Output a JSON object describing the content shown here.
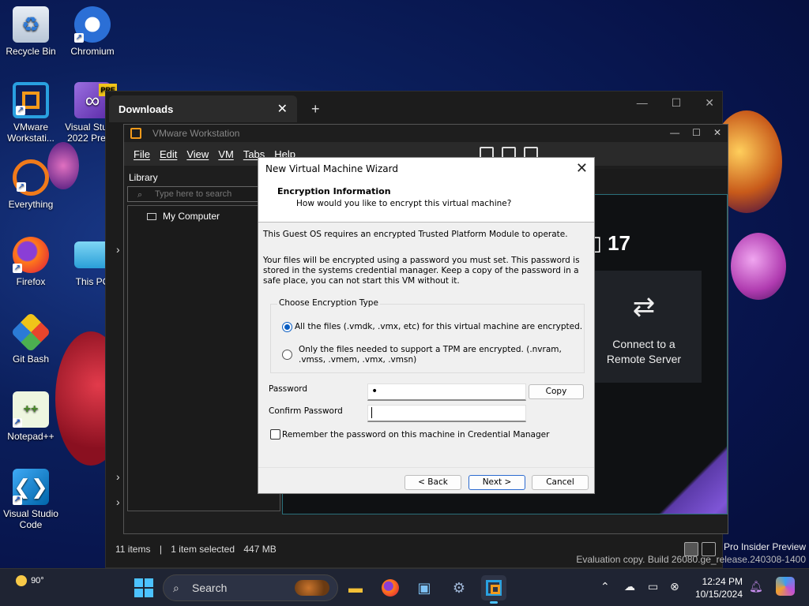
{
  "desktop": {
    "icons": [
      {
        "label": "Recycle Bin",
        "icon": "recycle-bin-icon"
      },
      {
        "label": "Chromium",
        "icon": "chromium-icon"
      },
      {
        "label": "VMware Workstati...",
        "icon": "vmware-icon"
      },
      {
        "label": "Visual Studio 2022 Prev...",
        "icon": "visual-studio-icon",
        "badge": "PRE"
      },
      {
        "label": "Everything",
        "icon": "everything-search-icon"
      },
      {
        "label": "Firefox",
        "icon": "firefox-icon"
      },
      {
        "label": "This PC",
        "icon": "this-pc-icon"
      },
      {
        "label": "Git Bash",
        "icon": "git-bash-icon"
      },
      {
        "label": "Notepad++",
        "icon": "notepad-plus-plus-icon"
      },
      {
        "label": "Visual Studio Code",
        "icon": "vscode-icon"
      }
    ]
  },
  "explorer": {
    "tab_title": "Downloads",
    "tab_close": "✕",
    "new_tab": "+",
    "status": {
      "items": "11 items",
      "separator": "|",
      "selected": "1 item selected",
      "size": "447 MB"
    }
  },
  "vmware": {
    "title": "VMware Workstation",
    "menu": [
      "File",
      "Edit",
      "View",
      "VM",
      "Tabs",
      "Help"
    ],
    "library": {
      "title": "Library",
      "search_placeholder": "Type here to search",
      "tree_item": "My Computer"
    },
    "brand_suffix": "17",
    "connect_card": {
      "line1": "Connect to a",
      "line2": "Remote Server",
      "icon": "swap-arrows-icon"
    }
  },
  "wizard": {
    "title": "New Virtual Machine Wizard",
    "header_title": "Encryption Information",
    "header_subtitle": "How would you like to encrypt this virtual machine?",
    "intro": "This Guest OS requires an encrypted Trusted Platform Module to operate.",
    "description": "Your files will be encrypted using a password you must set. This password is stored in the systems credential manager. Keep a copy of the password in a safe place, you can not start this VM without it.",
    "group_label": "Choose Encryption Type",
    "option_all": "All the files (.vmdk, .vmx, etc) for this virtual machine are encrypted.",
    "option_tpm": "Only the files needed to support a TPM are encrypted. (.nvram, .vmss, .vmem, .vmx, .vmsn)",
    "selected_option": "all",
    "password_label": "Password",
    "password_value": "•",
    "confirm_label": "Confirm Password",
    "confirm_value": "",
    "copy_button": "Copy",
    "remember_label": "Remember the password on this machine in Credential Manager",
    "remember_checked": false,
    "back_button": "< Back",
    "next_button": "Next >",
    "cancel_button": "Cancel"
  },
  "watermark": {
    "line1": "Pro Insider Preview",
    "line2": "Evaluation copy. Build 26080.ge_release.240308-1400"
  },
  "taskbar": {
    "weather_temp": "90°",
    "search_label": "Search",
    "apps": [
      "file-explorer-icon",
      "firefox-icon",
      "remote-desktop-icon",
      "settings-gear-icon",
      "vmware-icon"
    ],
    "time": "12:24 PM",
    "date": "10/15/2024"
  },
  "colors": {
    "accent": "#0a5dc2",
    "vmware_orange": "#f39a1b",
    "taskbar": "#1f2433"
  }
}
